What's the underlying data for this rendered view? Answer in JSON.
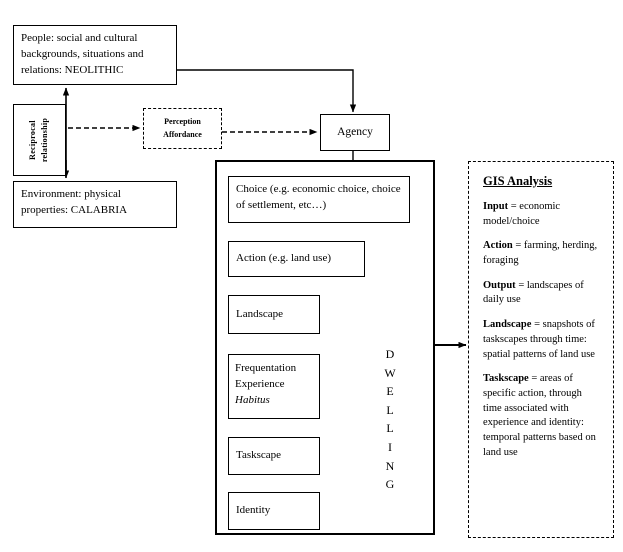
{
  "diagram": {
    "title_absent": true,
    "nodes": {
      "people": "People: social and cultural backgrounds, situations and relations: NEOLITHIC",
      "reciprocal": "Reciprocal\nrelationship",
      "environment": "Environment: physical properties: CALABRIA",
      "perception": "Perception\nAffordance",
      "agency": "Agency",
      "choice": "Choice (e.g. economic choice, choice of settlement, etc…)",
      "action": "Action (e.g. land use)",
      "landscape": "Landscape",
      "frequentation": "Frequentation\nExperience\nHabitus",
      "frequentation_line1": "Frequentation",
      "frequentation_line2": "Experience",
      "frequentation_line3": "Habitus",
      "taskscape": "Taskscape",
      "identity": "Identity",
      "dwelling": "D\nW\nE\nL\nL\nI\nN\nG"
    },
    "gis": {
      "title": "GIS Analysis",
      "entries": [
        {
          "term": "Input",
          "definition": " = economic model/choice"
        },
        {
          "term": "Action",
          "definition": " = farming, herding, foraging"
        },
        {
          "term": "Output",
          "definition": " = landscapes of daily use"
        },
        {
          "term": "Landscape",
          "definition": " = snapshots of taskscapes through time: spatial patterns of land use"
        },
        {
          "term": "Taskscape",
          "definition": " = areas of specific action, through time associated with experience and identity: temporal patterns based on land use"
        }
      ]
    },
    "colors": {
      "stroke": "#000000",
      "background": "#ffffff"
    }
  }
}
